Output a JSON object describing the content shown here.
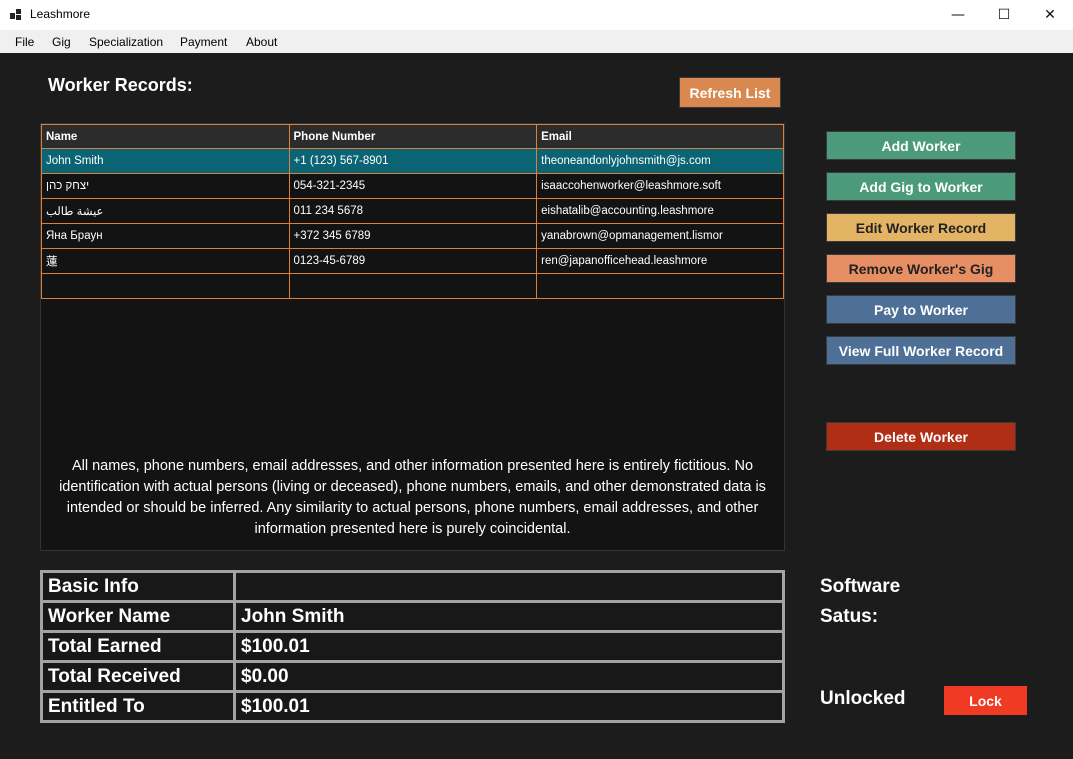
{
  "window": {
    "title": "Leashmore",
    "minimize_glyph": "—",
    "maximize_glyph": "☐",
    "close_glyph": "✕"
  },
  "menu": {
    "items": [
      "File",
      "Gig",
      "Specialization",
      "Payment",
      "About"
    ]
  },
  "main": {
    "heading": "Worker Records:",
    "refresh_label": "Refresh List",
    "table": {
      "columns": [
        "Name",
        "Phone Number",
        "Email"
      ],
      "rows": [
        {
          "name": "John Smith",
          "phone": "+1 (123) 567-8901",
          "email": "theoneandonlyjohnsmith@js.com"
        },
        {
          "name": "יצחק כהן",
          "phone": "054-321-2345",
          "email": "isaaccohenworker@leashmore.soft"
        },
        {
          "name": "عيشة طالب",
          "phone": "011 234 5678",
          "email": "eishatalib@accounting.leashmore"
        },
        {
          "name": "Яна Браун",
          "phone": "+372 345 6789",
          "email": "yanabrown@opmanagement.lismor"
        },
        {
          "name": "蓮",
          "phone": "0123-45-6789",
          "email": "ren@japanofficehead.leashmore"
        }
      ],
      "selected_row": 0
    },
    "disclaimer": "All names, phone numbers, email addresses, and other information presented here is entirely fictitious. No identification with actual persons (living or deceased), phone numbers, emails, and other demonstrated data is intended or should be inferred. Any similarity to actual persons, phone numbers, email addresses, and other information presented here is purely coincidental."
  },
  "actions": {
    "add_worker": "Add Worker",
    "add_gig": "Add Gig to Worker",
    "edit_record": "Edit Worker Record",
    "remove_gig": "Remove Worker's Gig",
    "pay_worker": "Pay to Worker",
    "view_full": "View Full Worker Record",
    "delete_worker": "Delete Worker"
  },
  "info": {
    "header": "Basic Info",
    "rows": [
      {
        "label": "Worker Name",
        "value": "John Smith"
      },
      {
        "label": "Total Earned",
        "value": "$100.01"
      },
      {
        "label": "Total Received",
        "value": "$0.00"
      },
      {
        "label": "Entitled To",
        "value": "$100.01"
      }
    ]
  },
  "status": {
    "title_line1": "Software",
    "title_line2": "Satus:",
    "state": "Unlocked",
    "lock_label": "Lock"
  },
  "colors": {
    "background": "#1c1c1c",
    "table_border": "#d8803c",
    "selected_row": "#0b6473",
    "refresh": "#d98850",
    "add_worker": "#4b9a7c",
    "add_gig": "#4b9a7c",
    "edit": "#e3b463",
    "remove_gig": "#e68e64",
    "pay": "#4e6f96",
    "view_full": "#4e6f96",
    "delete": "#b02e16",
    "lock": "#f03a23"
  }
}
